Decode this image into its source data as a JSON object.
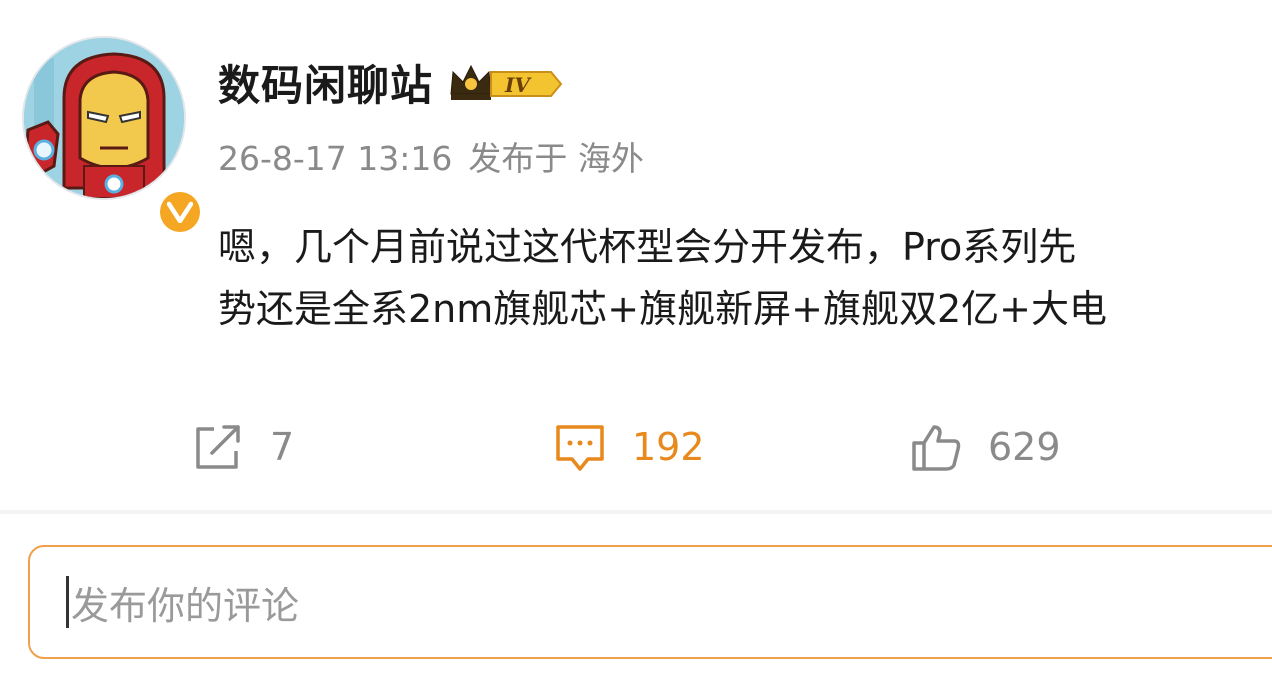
{
  "post": {
    "author": {
      "name": "数码闲聊站",
      "level_badge": "IV",
      "verified_icon": "verified-v-icon",
      "avatar_icon": "ironman-cartoon-avatar"
    },
    "meta": {
      "timestamp": "26-8-17 13:16",
      "location": "发布于 海外"
    },
    "content": {
      "line1": "嗯，几个月前说过这代杯型会分开发布，Pro系列先",
      "line2": "势还是全系2nm旗舰芯+旗舰新屏+旗舰双2亿+大电"
    },
    "actions": {
      "repost_count": "7",
      "comment_count": "192",
      "like_count": "629"
    }
  },
  "comment_input": {
    "placeholder": "发布你的评论"
  },
  "colors": {
    "accent_orange": "#e8891d",
    "input_border": "#f0a04b",
    "gray_text": "#8a8a8a",
    "verified_badge": "#f5a623"
  }
}
